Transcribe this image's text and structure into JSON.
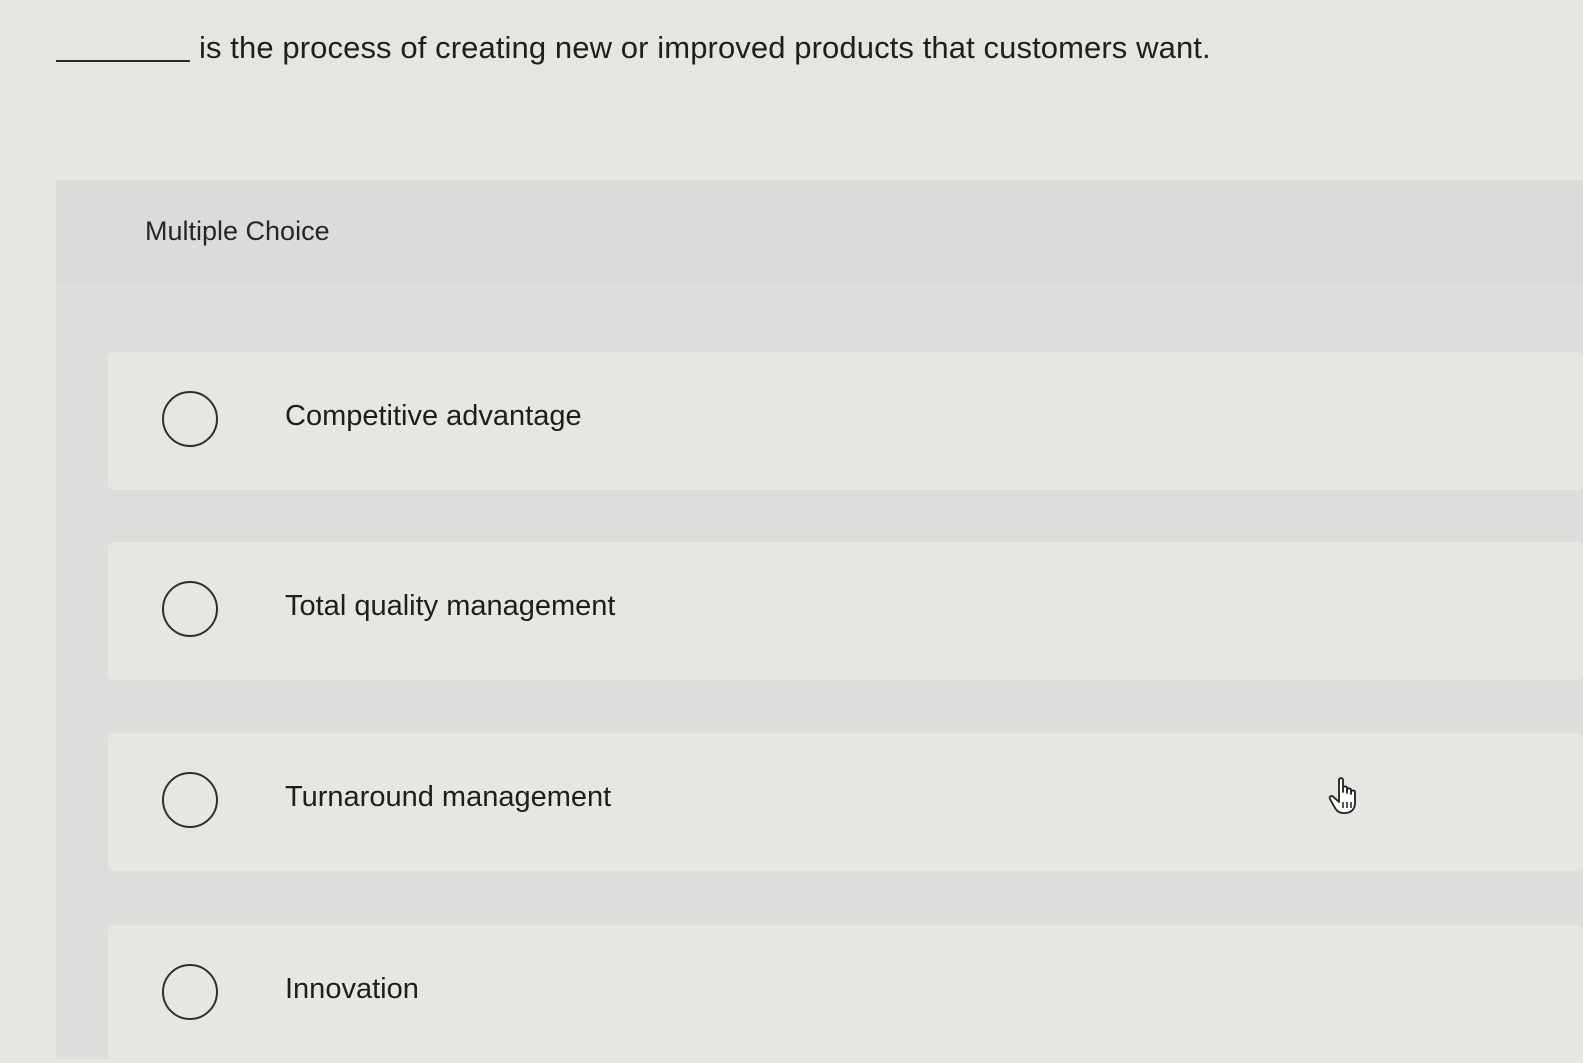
{
  "question": {
    "blank": "________",
    "text": "is the process of creating new or improved products that customers want."
  },
  "panel": {
    "heading": "Multiple Choice",
    "choices": [
      {
        "label": "Competitive advantage"
      },
      {
        "label": "Total quality management"
      },
      {
        "label": "Turnaround management"
      },
      {
        "label": "Innovation"
      }
    ]
  },
  "icons": {
    "cursor": "hand-pointer-icon",
    "radio": "radio-button-empty"
  },
  "colors": {
    "background": "#e6e5e1",
    "panel": "#dedddb",
    "choice_bg": "#e7e6e3",
    "text": "#1f1f1f"
  }
}
